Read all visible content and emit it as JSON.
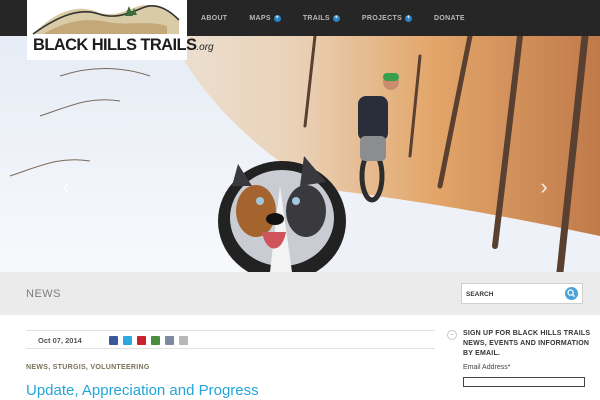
{
  "logo": {
    "main": "BLACK HILLS TRAILS",
    "suffix": ".org"
  },
  "nav": {
    "items": [
      {
        "label": "ABOUT",
        "has_submenu": false
      },
      {
        "label": "MAPS",
        "has_submenu": true
      },
      {
        "label": "TRAILS",
        "has_submenu": true
      },
      {
        "label": "PROJECTS",
        "has_submenu": true
      },
      {
        "label": "DONATE",
        "has_submenu": false
      }
    ],
    "submenu_icon": "plus-circle-icon",
    "submenu_glyph": "+"
  },
  "hero": {
    "prev_glyph": "‹",
    "next_glyph": "›"
  },
  "news_bar": {
    "title": "NEWS",
    "search": {
      "placeholder": "SEARCH",
      "value": ""
    }
  },
  "post": {
    "date": "Oct 07, 2014",
    "categories": [
      "NEWS",
      "STURGIS",
      "VOLUNTEERING"
    ],
    "title": "Update, Appreciation and Progress",
    "share_icons": [
      "facebook-icon",
      "twitter-icon",
      "pinterest-icon",
      "email-icon",
      "print-icon",
      "share-icon"
    ]
  },
  "signup": {
    "heading": "SIGN UP FOR BLACK HILLS TRAILS NEWS, EVENTS AND INFORMATION BY EMAIL.",
    "email_label": "Email Address",
    "required_mark": "*",
    "email_value": "",
    "toggle_glyph": "−"
  },
  "colors": {
    "nav_bg": "#262626",
    "link": "#23a5d9",
    "accent": "#2b84c6",
    "news_bar_bg": "#ebebeb"
  }
}
